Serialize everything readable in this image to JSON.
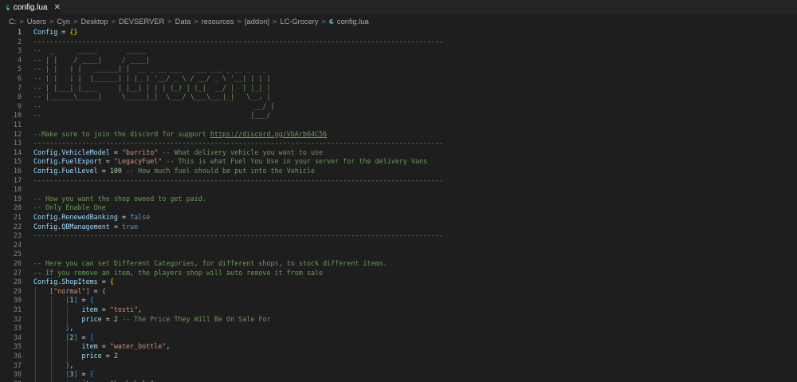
{
  "tab": {
    "title": "config.lua",
    "close": "✕"
  },
  "breadcrumb": [
    "C:",
    "Users",
    "Cyn",
    "Desktop",
    "DEVSERVER",
    "Data",
    "resources",
    "[addon]",
    "LC-Grocery",
    "config.lua"
  ],
  "breadcrumb_sep": ">",
  "active_line": 1,
  "lines": [
    [
      [
        "Config",
        "var"
      ],
      [
        " = ",
        ""
      ],
      [
        "{",
        "brace"
      ],
      [
        "}",
        "brace"
      ]
    ],
    [
      [
        "------------------------------------------------------------------------------------------------------",
        "com"
      ]
    ],
    [
      [
        "--  _      _____       _____",
        "com"
      ]
    ],
    [
      [
        "-- | |    / ____|     / ____|",
        "com"
      ]
    ],
    [
      [
        "-- | |   | |   ______| |  __ _ __ ___   ___ ___ _ __ _   _",
        "com"
      ]
    ],
    [
      [
        "-- | |   | |  |______| | |_ | '__/ _ \\ / __/ _ \\ '__| | | |",
        "com"
      ]
    ],
    [
      [
        "-- | |___| |____     | |__| | | | (_) | (_|  __/ |  | |_| |",
        "com"
      ]
    ],
    [
      [
        "-- |______\\_____|     \\_____|_|  \\___/ \\___\\___|_|   \\__, |",
        "com"
      ]
    ],
    [
      [
        "--                                                     __/ |",
        "com"
      ]
    ],
    [
      [
        "--                                                    |___/",
        "com"
      ]
    ],
    [],
    [
      [
        "--Make sure to join the discord for support ",
        "com"
      ],
      [
        "https://discord.gg/VbArb64C56",
        "link"
      ]
    ],
    [
      [
        "------------------------------------------------------------------------------------------------------",
        "com"
      ]
    ],
    [
      [
        "Config",
        "var"
      ],
      [
        ".",
        ""
      ],
      [
        "VehicleModel",
        "var"
      ],
      [
        " = ",
        ""
      ],
      [
        "\"burrito\"",
        "str"
      ],
      [
        " -- What delivery vehicle you want to use",
        "com"
      ]
    ],
    [
      [
        "Config",
        "var"
      ],
      [
        ".",
        ""
      ],
      [
        "FuelExport",
        "var"
      ],
      [
        " = ",
        ""
      ],
      [
        "\"LegacyFuel\"",
        "str"
      ],
      [
        " -- This is what Fuel You Use in your server for the delivery Vans",
        "com"
      ]
    ],
    [
      [
        "Config",
        "var"
      ],
      [
        ".",
        ""
      ],
      [
        "FuelLevel",
        "var"
      ],
      [
        " = ",
        ""
      ],
      [
        "100",
        "num"
      ],
      [
        " -- How much fuel should be put into the Vehicle",
        "com"
      ]
    ],
    [
      [
        "------------------------------------------------------------------------------------------------------",
        "com"
      ]
    ],
    [],
    [
      [
        "-- How you want the shop owned to get paid.",
        "com"
      ]
    ],
    [
      [
        "-- Only Enable One",
        "com"
      ]
    ],
    [
      [
        "Config",
        "var"
      ],
      [
        ".",
        ""
      ],
      [
        "RenewedBanking",
        "var"
      ],
      [
        " = ",
        ""
      ],
      [
        "false",
        "bool"
      ]
    ],
    [
      [
        "Config",
        "var"
      ],
      [
        ".",
        ""
      ],
      [
        "QBManagement",
        "var"
      ],
      [
        " = ",
        ""
      ],
      [
        "true",
        "bool"
      ]
    ],
    [
      [
        "------------------------------------------------------------------------------------------------------",
        "com"
      ]
    ],
    [],
    [],
    [
      [
        "-- Here you can set Different Categories, for different shops, to stock different items.",
        "com"
      ]
    ],
    [
      [
        "-- If you remove an item, the players shop will auto remove it from sale",
        "com"
      ]
    ],
    [
      [
        "Config",
        "var"
      ],
      [
        ".",
        ""
      ],
      [
        "ShopItems",
        "var"
      ],
      [
        " = ",
        ""
      ],
      [
        "{",
        "brace"
      ]
    ],
    [
      [
        "    ",
        ""
      ],
      [
        "[",
        "brace2"
      ],
      [
        "\"normal\"",
        "str"
      ],
      [
        "]",
        "brace2"
      ],
      [
        " = ",
        ""
      ],
      [
        "{",
        "brace2"
      ]
    ],
    [
      [
        "        ",
        ""
      ],
      [
        "[",
        "brace3"
      ],
      [
        "1",
        "num"
      ],
      [
        "]",
        "brace3"
      ],
      [
        " = ",
        ""
      ],
      [
        "{",
        "brace3"
      ]
    ],
    [
      [
        "            ",
        ""
      ],
      [
        "item",
        "var"
      ],
      [
        " = ",
        ""
      ],
      [
        "\"tosti\"",
        "str"
      ],
      [
        ",",
        ""
      ]
    ],
    [
      [
        "            ",
        ""
      ],
      [
        "price",
        "var"
      ],
      [
        " = ",
        ""
      ],
      [
        "2",
        "num"
      ],
      [
        " -- The Price They Will Be On Sale For",
        "com"
      ]
    ],
    [
      [
        "        ",
        ""
      ],
      [
        "}",
        "brace3"
      ],
      [
        ",",
        ""
      ]
    ],
    [
      [
        "        ",
        ""
      ],
      [
        "[",
        "brace3"
      ],
      [
        "2",
        "num"
      ],
      [
        "]",
        "brace3"
      ],
      [
        " = ",
        ""
      ],
      [
        "{",
        "brace3"
      ]
    ],
    [
      [
        "            ",
        ""
      ],
      [
        "item",
        "var"
      ],
      [
        " = ",
        ""
      ],
      [
        "\"water_bottle\"",
        "str"
      ],
      [
        ",",
        ""
      ]
    ],
    [
      [
        "            ",
        ""
      ],
      [
        "price",
        "var"
      ],
      [
        " = ",
        ""
      ],
      [
        "2",
        "num"
      ]
    ],
    [
      [
        "        ",
        ""
      ],
      [
        "}",
        "brace3"
      ],
      [
        ",",
        ""
      ]
    ],
    [
      [
        "        ",
        ""
      ],
      [
        "[",
        "brace3"
      ],
      [
        "3",
        "num"
      ],
      [
        "]",
        "brace3"
      ],
      [
        " = ",
        ""
      ],
      [
        "{",
        "brace3"
      ]
    ],
    [
      [
        "            ",
        ""
      ],
      [
        "item",
        "var"
      ],
      [
        " = ",
        ""
      ],
      [
        "\"kurkakola\"",
        "str"
      ],
      [
        ",",
        ""
      ]
    ]
  ]
}
